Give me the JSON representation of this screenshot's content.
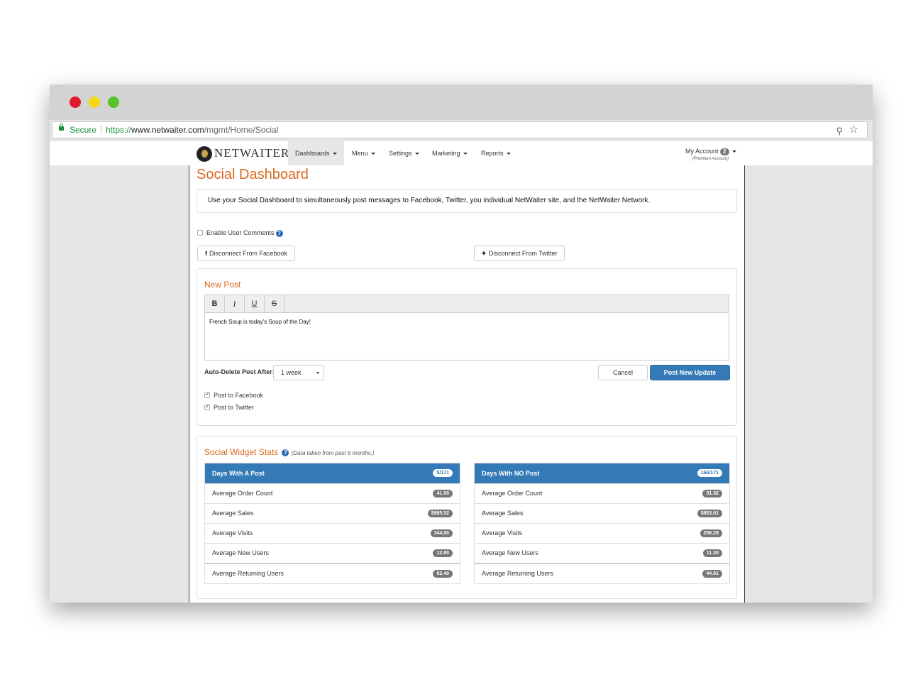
{
  "browser": {
    "secure_label": "Secure",
    "url_scheme": "https://",
    "url_host": "www.netwaiter.com",
    "url_path": "/mgmt/Home/Social"
  },
  "nav": {
    "brand": "NETWAITER",
    "items": [
      {
        "label": "Dashboards"
      },
      {
        "label": "Menu"
      },
      {
        "label": "Settings"
      },
      {
        "label": "Marketing"
      },
      {
        "label": "Reports"
      }
    ],
    "account_label": "My Account",
    "account_count": "2",
    "account_type": "(Premium Account)"
  },
  "page": {
    "title": "Social Dashboard",
    "description": "Use your Social Dashboard to simultaneously post messages to Facebook, Twitter, you individual NetWaiter site, and the NetWaiter Network.",
    "enable_comments_label": "Enable User Comments",
    "facebook_button": "Disconnect From Facebook",
    "twitter_button": "Disconnect From Twitter"
  },
  "new_post": {
    "title": "New Post",
    "toolbar": [
      "B",
      "I",
      "U",
      "S"
    ],
    "text": "French Soup is today's Soup of the Day!",
    "auto_delete_label": "Auto-Delete Post After:",
    "auto_delete_value": "1 week",
    "cancel": "Cancel",
    "post": "Post New Update",
    "post_facebook": "Post to Facebook",
    "post_twitter": "Post to Twitter"
  },
  "stats": {
    "title": "Social Widget Stats",
    "note": "(Data taken from past 6 months.)",
    "with_post": {
      "header": "Days With A Post",
      "count": "5/171",
      "rows": [
        {
          "label": "Average Order Count",
          "value": "41.00"
        },
        {
          "label": "Average Sales",
          "value": "$985.52"
        },
        {
          "label": "Average Visits",
          "value": "344.00"
        },
        {
          "label": "Average New Users",
          "value": "12.80"
        },
        {
          "label": "Average Returning Users",
          "value": "62.40"
        }
      ]
    },
    "no_post": {
      "header": "Days With NO Post",
      "count": "166/171",
      "rows": [
        {
          "label": "Average Order Count",
          "value": "31.32"
        },
        {
          "label": "Average Sales",
          "value": "$853.61"
        },
        {
          "label": "Average Visits",
          "value": "256.28"
        },
        {
          "label": "Average New Users",
          "value": "11.30"
        },
        {
          "label": "Average Returning Users",
          "value": "44.61"
        }
      ]
    }
  }
}
